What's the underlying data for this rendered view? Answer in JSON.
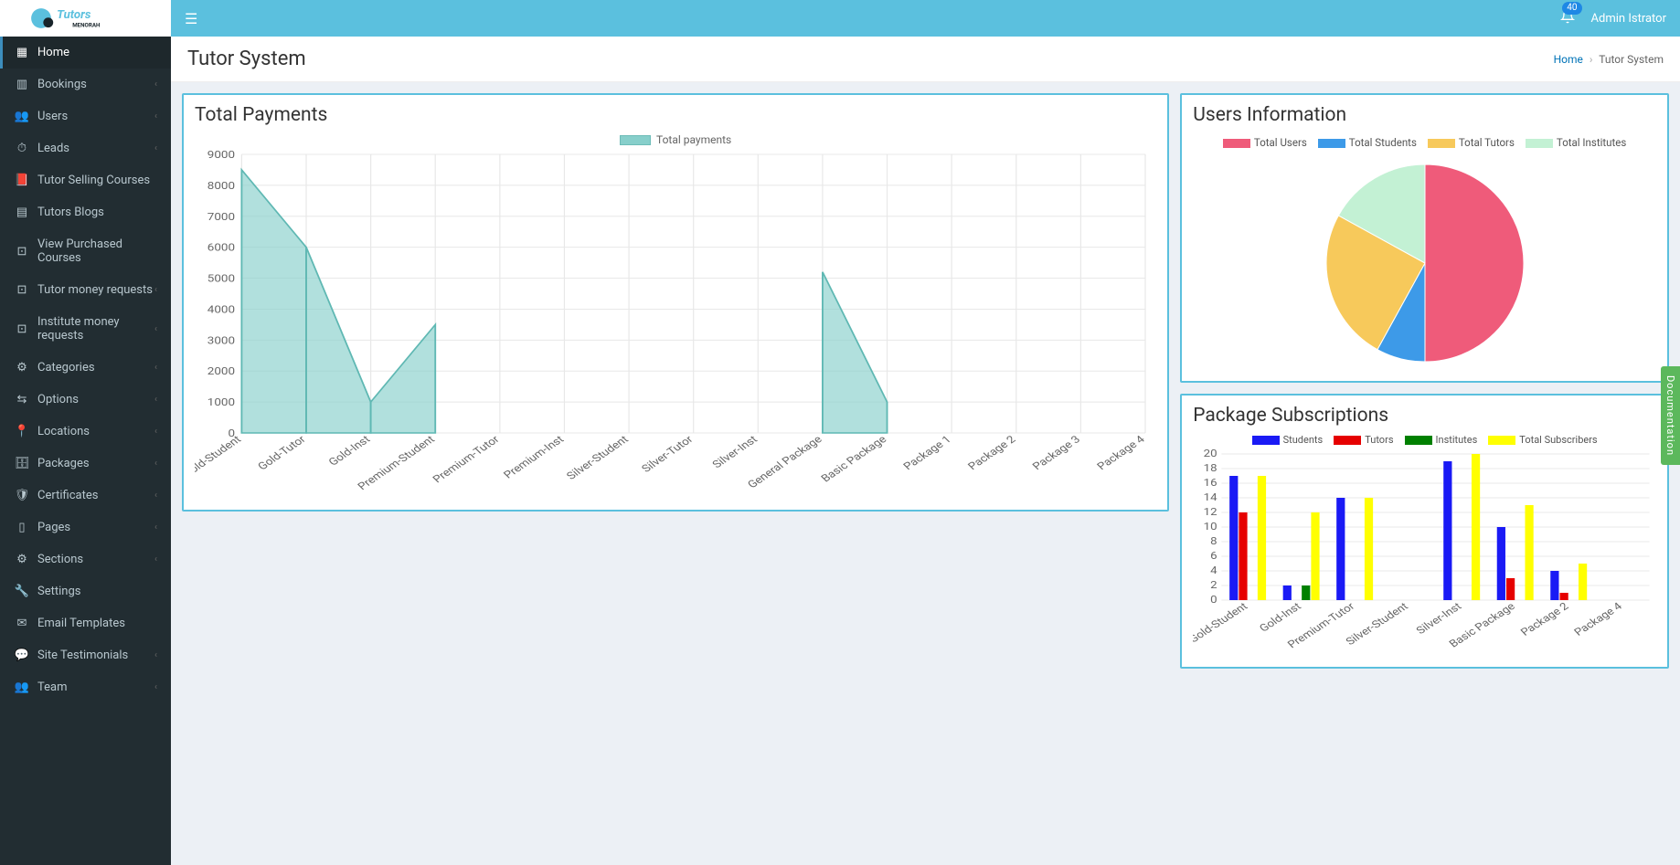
{
  "brand": {
    "name": "Tutors",
    "sub": "MENORAH"
  },
  "topbar": {
    "badge": "40",
    "user": "Admin Istrator"
  },
  "page": {
    "title": "Tutor System"
  },
  "breadcrumb": {
    "home": "Home",
    "current": "Tutor System"
  },
  "sidebar": {
    "items": [
      {
        "icon": "dashboard",
        "label": "Home",
        "active": true,
        "chevron": false
      },
      {
        "icon": "calendar",
        "label": "Bookings",
        "chevron": true
      },
      {
        "icon": "users",
        "label": "Users",
        "chevron": true
      },
      {
        "icon": "clock",
        "label": "Leads",
        "chevron": true
      },
      {
        "icon": "book",
        "label": "Tutor Selling Courses",
        "chevron": false
      },
      {
        "icon": "newspaper",
        "label": "Tutors Blogs",
        "chevron": false
      },
      {
        "icon": "cart",
        "label": "View Purchased Courses",
        "chevron": false
      },
      {
        "icon": "money",
        "label": "Tutor money requests",
        "chevron": true
      },
      {
        "icon": "money",
        "label": "Institute money requests",
        "chevron": true
      },
      {
        "icon": "gear",
        "label": "Categories",
        "chevron": true
      },
      {
        "icon": "sliders",
        "label": "Options",
        "chevron": true
      },
      {
        "icon": "pin",
        "label": "Locations",
        "chevron": true
      },
      {
        "icon": "archive",
        "label": "Packages",
        "chevron": true
      },
      {
        "icon": "shield",
        "label": "Certificates",
        "chevron": true
      },
      {
        "icon": "file",
        "label": "Pages",
        "chevron": true
      },
      {
        "icon": "gear",
        "label": "Sections",
        "chevron": true
      },
      {
        "icon": "wrench",
        "label": "Settings",
        "chevron": false
      },
      {
        "icon": "mail",
        "label": "Email Templates",
        "chevron": false
      },
      {
        "icon": "comment",
        "label": "Site Testimonials",
        "chevron": true
      },
      {
        "icon": "users",
        "label": "Team",
        "chevron": true
      }
    ]
  },
  "panels": {
    "payments": {
      "title": "Total Payments",
      "legend": "Total payments"
    },
    "users": {
      "title": "Users Information"
    },
    "subs": {
      "title": "Package Subscriptions"
    }
  },
  "doc_tab": "Documentation",
  "chart_data": [
    {
      "type": "area",
      "title": "Total Payments",
      "series_name": "Total payments",
      "categories": [
        "Gold-Student",
        "Gold-Tutor",
        "Gold-Inst",
        "Premium-Student",
        "Premium-Tutor",
        "Premium-Inst",
        "Silver-Student",
        "Silver-Tutor",
        "Silver-Inst",
        "General Package",
        "Basic Package",
        "Package 1",
        "Package 2",
        "Package 3",
        "Package 4"
      ],
      "values": [
        8500,
        6000,
        1000,
        3500,
        0,
        0,
        0,
        0,
        0,
        5200,
        1000,
        0,
        0,
        0,
        0
      ],
      "ylim": [
        0,
        9000
      ],
      "ystep": 1000
    },
    {
      "type": "pie",
      "title": "Users Information",
      "series": [
        {
          "name": "Total Users",
          "value": 50,
          "color": "#ef5b7a"
        },
        {
          "name": "Total Students",
          "value": 8,
          "color": "#3d9ae8"
        },
        {
          "name": "Total Tutors",
          "value": 25,
          "color": "#f7c95b"
        },
        {
          "name": "Total Institutes",
          "value": 17,
          "color": "#c3f1d4"
        }
      ]
    },
    {
      "type": "bar",
      "title": "Package Subscriptions",
      "categories": [
        "Gold-Student",
        "Gold-Inst",
        "Premium-Tutor",
        "Silver-Student",
        "Silver-Inst",
        "Basic Package",
        "Package 2",
        "Package 4"
      ],
      "series": [
        {
          "name": "Students",
          "values": [
            17,
            2,
            14,
            0,
            19,
            10,
            4,
            0
          ],
          "color": "#1a1af5"
        },
        {
          "name": "Tutors",
          "values": [
            12,
            0,
            0,
            0,
            0,
            3,
            1,
            0
          ],
          "color": "#e60000"
        },
        {
          "name": "Institutes",
          "values": [
            0,
            2,
            0,
            0,
            0,
            0,
            0,
            0
          ],
          "color": "#008000"
        },
        {
          "name": "Total Subscribers",
          "values": [
            17,
            12,
            14,
            0,
            20,
            13,
            5,
            0
          ],
          "color": "#ffff00"
        }
      ],
      "ylim": [
        0,
        20
      ],
      "ystep": 2
    }
  ]
}
